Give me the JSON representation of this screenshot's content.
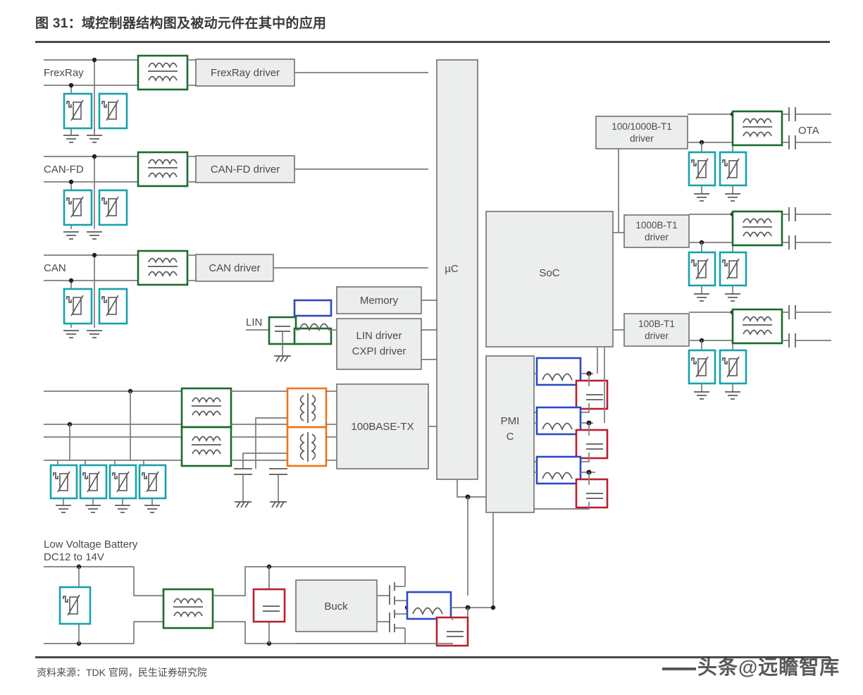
{
  "header": {
    "title": "图 31：域控制器结构图及被动元件在其中的应用"
  },
  "footer": {
    "source": "资料来源：TDK 官网，民生证券研究院",
    "watermark": "头条@远瞻智库"
  },
  "colors": {
    "common_mode_choke": "#1b6b2b",
    "esd_varistor": "#17a2ad",
    "inductor": "#2b49c4",
    "capacitor": "#b91f2e",
    "transformer": "#f07419",
    "block_fill": "#eceeed",
    "block_stroke": "#6f6f6f",
    "wire": "#7b7b7b",
    "title_text": "#3a3a3a"
  },
  "diagram": {
    "bus_labels": [
      {
        "id": "frexray",
        "text": "FrexRay"
      },
      {
        "id": "canfd",
        "text": "CAN-FD"
      },
      {
        "id": "can",
        "text": "CAN"
      },
      {
        "id": "lin",
        "text": "LIN"
      },
      {
        "id": "ota",
        "text": "OTA"
      }
    ],
    "blocks": [
      {
        "id": "frexray-driver",
        "text": "FrexRay driver"
      },
      {
        "id": "canfd-driver",
        "text": "CAN-FD driver"
      },
      {
        "id": "can-driver",
        "text": "CAN driver"
      },
      {
        "id": "memory",
        "text": "Memory"
      },
      {
        "id": "lin-cxpi-driver",
        "line1": "LIN driver",
        "line2": "CXPI driver"
      },
      {
        "id": "base100tx",
        "text": "100BASE-TX"
      },
      {
        "id": "mcu",
        "text": "µC"
      },
      {
        "id": "soc",
        "text": "SoC"
      },
      {
        "id": "pmic",
        "line1": "PMI",
        "line2": "C"
      },
      {
        "id": "driver-100-1000bt1",
        "line1": "100/1000B-T1",
        "line2": "driver"
      },
      {
        "id": "driver-1000bt1",
        "line1": "1000B-T1",
        "line2": "driver"
      },
      {
        "id": "driver-100bt1",
        "line1": "100B-T1",
        "line2": "driver"
      },
      {
        "id": "buck",
        "text": "Buck"
      }
    ],
    "battery": {
      "line1": "Low Voltage Battery",
      "line2": "DC12 to 14V"
    },
    "legend_symbols": [
      {
        "name": "common-mode-choke",
        "color": "#1b6b2b"
      },
      {
        "name": "esd-varistor",
        "color": "#17a2ad"
      },
      {
        "name": "power-inductor",
        "color": "#2b49c4"
      },
      {
        "name": "capacitor",
        "color": "#b91f2e"
      },
      {
        "name": "pulse-transformer",
        "color": "#f07419"
      }
    ]
  }
}
